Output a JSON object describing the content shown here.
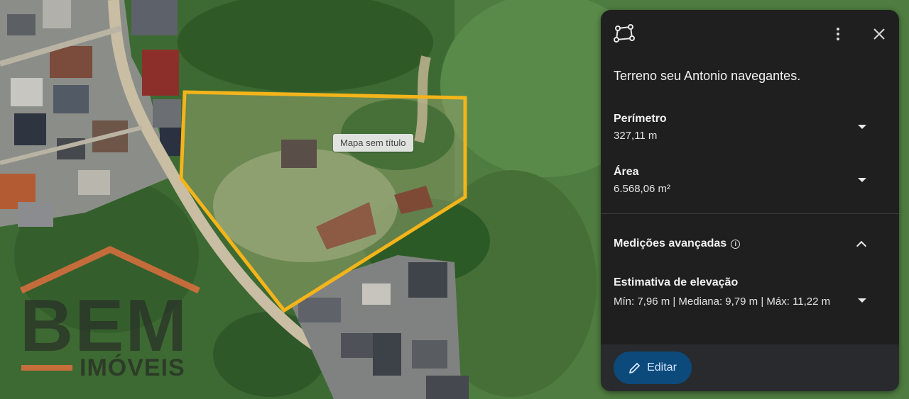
{
  "map": {
    "label": "Mapa sem título"
  },
  "watermark": {
    "word": "BEM",
    "sub": "IMÓVEIS"
  },
  "panel": {
    "title": "Terreno seu Antonio navegantes.",
    "perimeter": {
      "label": "Perímetro",
      "value": "327,11 m"
    },
    "area": {
      "label": "Área",
      "value": "6.568,06 m²"
    },
    "advanced": {
      "title": "Medições avançadas",
      "elevation_label": "Estimativa de elevação",
      "elevation_value": "Mín: 7,96 m | Mediana: 9,79 m | Máx: 11,22 m"
    },
    "edit_label": "Editar"
  },
  "colors": {
    "polygon": "#f4b41a",
    "panel_bg": "#1f1f1f",
    "edit_button": "#0c4a7c"
  }
}
